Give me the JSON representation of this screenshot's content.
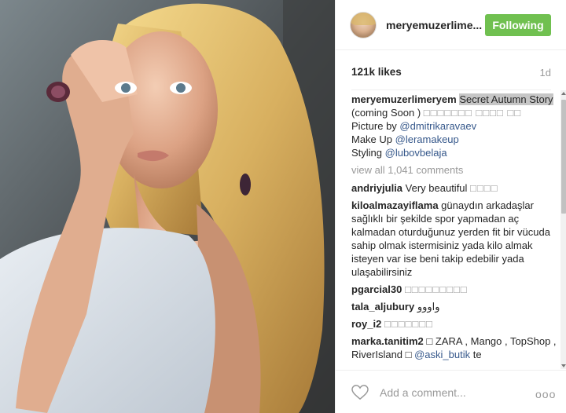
{
  "post": {
    "username": "meryemuzerlime...",
    "follow_label": "Following",
    "likes": "121k likes",
    "time": "1d"
  },
  "caption": {
    "username": "meryemuzerlimeryem",
    "highlight_text": "Secret Autumn Story",
    "text_after": " (coming Soon )",
    "boxes_1": "□□□□□□□ □□□□ □□",
    "picture_by_label": "Picture by ",
    "picture_by_user": "@dmitrikaravaev",
    "makeup_label": "Make Up ",
    "makeup_user": "@leramakeup",
    "styling_label": "Styling ",
    "styling_user": "@lubovbelaja"
  },
  "view_all": "view all 1,041 comments",
  "comments": [
    {
      "user": "andriyjulia",
      "text": " Very beautiful ",
      "extra": "□□□□"
    },
    {
      "user": "kiloalmazayiflama",
      "text": " günaydın arkadaşlar sağlıklı bir şekilde spor yapmadan aç kalmadan oturduğunuz yerden fit bir vücuda sahip olmak istermisiniz yada kilo almak isteyen var ise beni takip edebilir yada ulaşabilirsiniz",
      "extra": ""
    },
    {
      "user": "pgarcial30",
      "text": " ",
      "extra": "□□□□□□□□□"
    },
    {
      "user": "tala_aljubury",
      "text": " واووو",
      "extra": ""
    },
    {
      "user": "roy_i2",
      "text": " ",
      "extra": "□□□□□□□"
    },
    {
      "user": "marka.tanitim2",
      "text": " □ ZARA , Mango , TopShop , RiverIsland □ ",
      "mention": "@aski_butik",
      "after": " te"
    }
  ],
  "footer": {
    "placeholder": "Add a comment...",
    "more": "ooo"
  },
  "icons": {
    "heart": "heart-icon",
    "more": "more-options-icon"
  }
}
